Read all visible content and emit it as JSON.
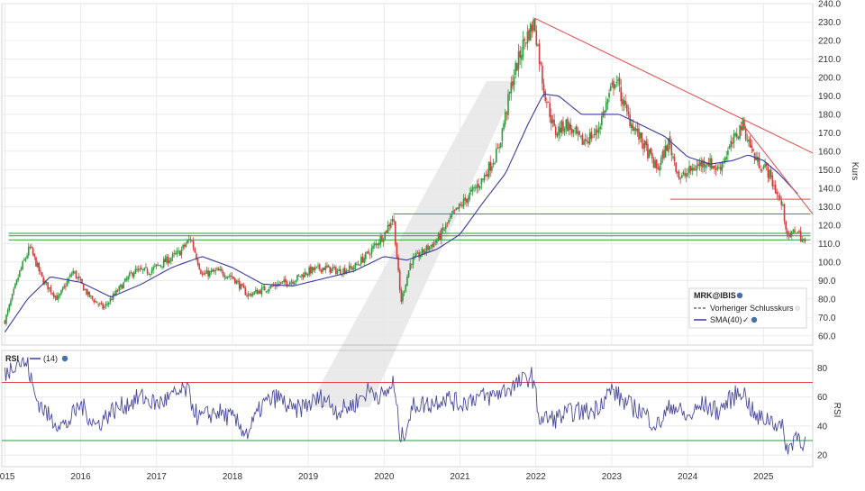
{
  "chart_data": [
    {
      "type": "candlestick",
      "symbol": "MRK@IBIS",
      "ylabel": "Kurs",
      "xlim": [
        2014.96,
        2025.65
      ],
      "ylim": [
        55,
        240
      ],
      "yticks": [
        60,
        70,
        80,
        90,
        100,
        110,
        120,
        130,
        140,
        150,
        160,
        170,
        180,
        190,
        200,
        210,
        220,
        230,
        240
      ],
      "ytick_labels": [
        "60.0",
        "70.0",
        "80.0",
        "90.0",
        "100.0",
        "110.0",
        "120.0",
        "130.0",
        "140.0",
        "150.0",
        "160.0",
        "170.0",
        "180.0",
        "190.0",
        "200.0",
        "210.0",
        "220.0",
        "230.0",
        "240.0"
      ],
      "xticks": [
        2015,
        2016,
        2017,
        2018,
        2019,
        2020,
        2021,
        2022,
        2023,
        2024,
        2025
      ],
      "xtick_labels": [
        "2015",
        "2016",
        "2017",
        "2018",
        "2019",
        "2020",
        "2021",
        "2022",
        "2023",
        "2024",
        "2025"
      ],
      "grid": true,
      "legend": {
        "position": "bottom-right",
        "title": "MRK@IBIS",
        "items": [
          "Vorheriger Schlusskurs",
          "SMA(40)"
        ]
      },
      "price_anchors": [
        [
          2015.0,
          68
        ],
        [
          2015.2,
          95
        ],
        [
          2015.33,
          108
        ],
        [
          2015.5,
          90
        ],
        [
          2015.7,
          80
        ],
        [
          2015.9,
          95
        ],
        [
          2016.1,
          82
        ],
        [
          2016.3,
          75
        ],
        [
          2016.5,
          85
        ],
        [
          2016.7,
          95
        ],
        [
          2016.9,
          95
        ],
        [
          2017.1,
          100
        ],
        [
          2017.3,
          105
        ],
        [
          2017.45,
          113
        ],
        [
          2017.6,
          93
        ],
        [
          2017.8,
          95
        ],
        [
          2018.0,
          92
        ],
        [
          2018.2,
          82
        ],
        [
          2018.4,
          85
        ],
        [
          2018.6,
          88
        ],
        [
          2018.8,
          90
        ],
        [
          2019.0,
          95
        ],
        [
          2019.2,
          97
        ],
        [
          2019.4,
          95
        ],
        [
          2019.6,
          97
        ],
        [
          2019.8,
          105
        ],
        [
          2020.0,
          115
        ],
        [
          2020.12,
          125
        ],
        [
          2020.22,
          78
        ],
        [
          2020.35,
          100
        ],
        [
          2020.5,
          105
        ],
        [
          2020.7,
          112
        ],
        [
          2020.9,
          125
        ],
        [
          2021.1,
          135
        ],
        [
          2021.3,
          145
        ],
        [
          2021.5,
          160
        ],
        [
          2021.7,
          200
        ],
        [
          2021.85,
          220
        ],
        [
          2021.98,
          230
        ],
        [
          2022.1,
          195
        ],
        [
          2022.25,
          170
        ],
        [
          2022.4,
          175
        ],
        [
          2022.6,
          165
        ],
        [
          2022.8,
          170
        ],
        [
          2023.05,
          200
        ],
        [
          2023.2,
          180
        ],
        [
          2023.4,
          165
        ],
        [
          2023.6,
          150
        ],
        [
          2023.75,
          165
        ],
        [
          2023.9,
          145
        ],
        [
          2024.05,
          150
        ],
        [
          2024.25,
          155
        ],
        [
          2024.4,
          150
        ],
        [
          2024.6,
          165
        ],
        [
          2024.72,
          175
        ],
        [
          2024.9,
          155
        ],
        [
          2025.05,
          150
        ],
        [
          2025.15,
          140
        ],
        [
          2025.25,
          130
        ],
        [
          2025.33,
          112
        ],
        [
          2025.42,
          118
        ],
        [
          2025.55,
          110
        ]
      ],
      "sma40_anchors": [
        [
          2015.0,
          62
        ],
        [
          2015.3,
          80
        ],
        [
          2015.6,
          92
        ],
        [
          2016.0,
          89
        ],
        [
          2016.4,
          81
        ],
        [
          2016.8,
          88
        ],
        [
          2017.2,
          97
        ],
        [
          2017.6,
          103
        ],
        [
          2018.0,
          97
        ],
        [
          2018.4,
          88
        ],
        [
          2018.8,
          87
        ],
        [
          2019.2,
          91
        ],
        [
          2019.6,
          95
        ],
        [
          2020.0,
          103
        ],
        [
          2020.3,
          101
        ],
        [
          2020.7,
          107
        ],
        [
          2021.0,
          115
        ],
        [
          2021.3,
          132
        ],
        [
          2021.6,
          148
        ],
        [
          2021.9,
          175
        ],
        [
          2022.1,
          191
        ],
        [
          2022.3,
          190
        ],
        [
          2022.6,
          180
        ],
        [
          2022.9,
          180
        ],
        [
          2023.1,
          180
        ],
        [
          2023.4,
          174
        ],
        [
          2023.7,
          168
        ],
        [
          2024.0,
          157
        ],
        [
          2024.3,
          153
        ],
        [
          2024.6,
          155
        ],
        [
          2024.8,
          158
        ],
        [
          2025.0,
          155
        ],
        [
          2025.2,
          148
        ],
        [
          2025.45,
          137
        ]
      ],
      "support_lines": [
        {
          "color": "#2e9b3c",
          "y": 115.5,
          "x0": 2015.05,
          "x1": 2025.62
        },
        {
          "color": "#2e9b3c",
          "y": 114.2,
          "x0": 2015.05,
          "x1": 2025.62
        },
        {
          "color": "#2e9b3c",
          "y": 112.0,
          "x0": 2015.05,
          "x1": 2025.62
        }
      ],
      "resistance_lines": [
        {
          "color": "#e04a4a",
          "y": 126,
          "x0": 2020.12,
          "x1": 2025.62
        },
        {
          "color": "#e04a4a",
          "y": 134,
          "x0": 2023.77,
          "x1": 2025.62
        }
      ],
      "trend_lines": [
        {
          "color": "#e04a4a",
          "x0": 2021.99,
          "y0": 232,
          "x1": 2025.65,
          "y1": 159
        },
        {
          "color": "#e04a4a",
          "x0": 2024.7,
          "y0": 176,
          "x1": 2025.65,
          "y1": 126
        }
      ]
    },
    {
      "type": "line",
      "name": "RSI",
      "period": "(14)",
      "ylabel": "RSI",
      "ylim": [
        12,
        92
      ],
      "yticks": [
        20,
        40,
        60,
        80
      ],
      "ytick_labels": [
        "20",
        "40",
        "60",
        "80"
      ],
      "overbought": 70,
      "oversold": 30,
      "rsi_anchors": [
        [
          2015.0,
          75
        ],
        [
          2015.15,
          85
        ],
        [
          2015.3,
          82
        ],
        [
          2015.4,
          60
        ],
        [
          2015.6,
          45
        ],
        [
          2015.8,
          40
        ],
        [
          2016.0,
          55
        ],
        [
          2016.2,
          40
        ],
        [
          2016.4,
          50
        ],
        [
          2016.6,
          55
        ],
        [
          2016.8,
          60
        ],
        [
          2017.0,
          55
        ],
        [
          2017.2,
          60
        ],
        [
          2017.4,
          65
        ],
        [
          2017.55,
          45
        ],
        [
          2017.8,
          50
        ],
        [
          2018.0,
          45
        ],
        [
          2018.2,
          35
        ],
        [
          2018.4,
          55
        ],
        [
          2018.6,
          60
        ],
        [
          2018.8,
          50
        ],
        [
          2019.0,
          55
        ],
        [
          2019.2,
          60
        ],
        [
          2019.4,
          50
        ],
        [
          2019.6,
          55
        ],
        [
          2019.8,
          65
        ],
        [
          2020.0,
          60
        ],
        [
          2020.12,
          70
        ],
        [
          2020.22,
          30
        ],
        [
          2020.4,
          55
        ],
        [
          2020.6,
          55
        ],
        [
          2020.8,
          60
        ],
        [
          2021.0,
          55
        ],
        [
          2021.2,
          60
        ],
        [
          2021.4,
          60
        ],
        [
          2021.6,
          65
        ],
        [
          2021.8,
          70
        ],
        [
          2021.95,
          75
        ],
        [
          2022.05,
          45
        ],
        [
          2022.25,
          45
        ],
        [
          2022.5,
          50
        ],
        [
          2022.75,
          50
        ],
        [
          2023.0,
          65
        ],
        [
          2023.2,
          55
        ],
        [
          2023.4,
          50
        ],
        [
          2023.6,
          40
        ],
        [
          2023.8,
          55
        ],
        [
          2024.0,
          45
        ],
        [
          2024.2,
          55
        ],
        [
          2024.4,
          50
        ],
        [
          2024.6,
          60
        ],
        [
          2024.72,
          65
        ],
        [
          2024.9,
          45
        ],
        [
          2025.1,
          45
        ],
        [
          2025.25,
          38
        ],
        [
          2025.33,
          22
        ],
        [
          2025.42,
          35
        ],
        [
          2025.55,
          28
        ]
      ]
    }
  ],
  "colors": {
    "up_candle": "#2e9b3c",
    "down_candle": "#d63a3a",
    "sma": "#3a3aa0",
    "rsi": "#4a4a9e",
    "grid": "#e6e6e6",
    "background": "#ffffff"
  }
}
